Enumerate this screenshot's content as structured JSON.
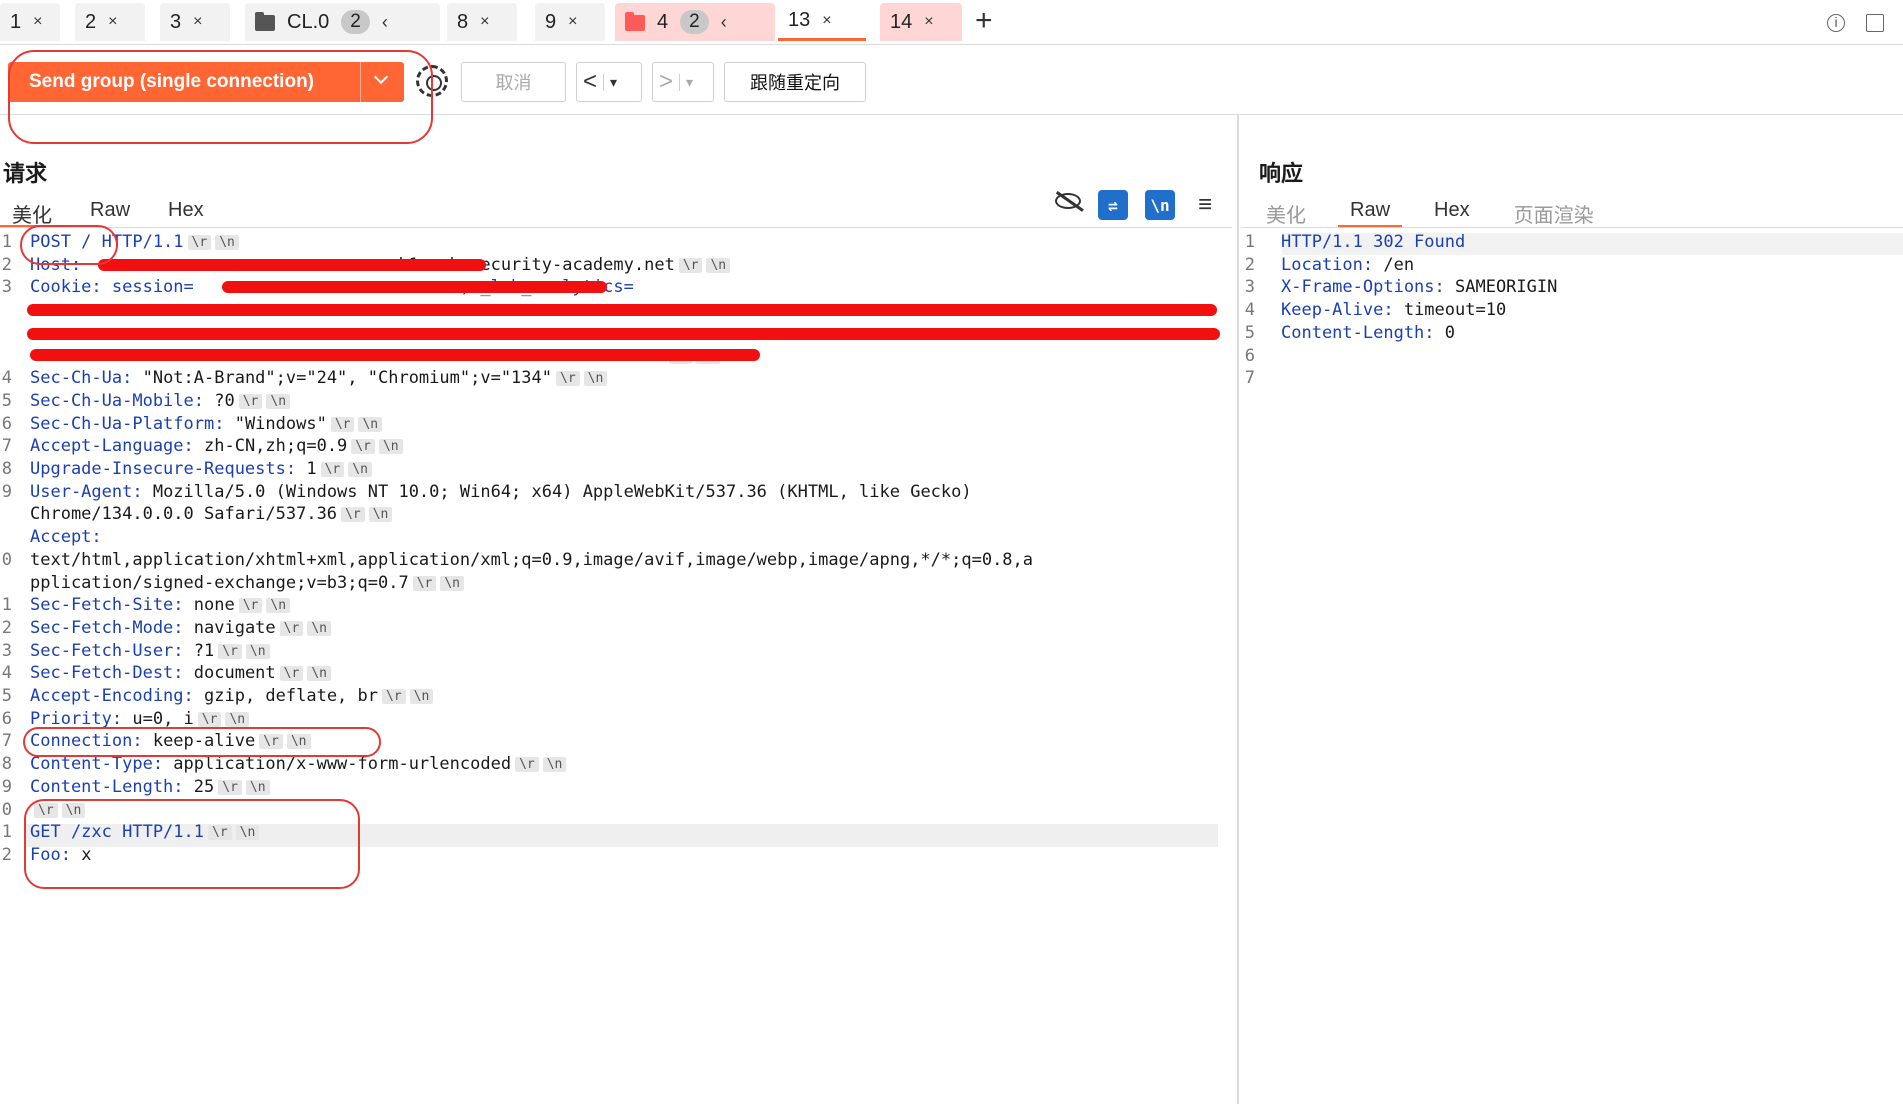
{
  "tabs": [
    {
      "label": "1",
      "close": "×"
    },
    {
      "label": "2",
      "close": "×"
    },
    {
      "label": "3",
      "close": "×"
    },
    {
      "label": "CL.0",
      "count": "2",
      "nav": "‹"
    },
    {
      "label": "8",
      "close": "×"
    },
    {
      "label": "9",
      "close": "×"
    },
    {
      "label": "4",
      "count": "2",
      "nav": "‹"
    },
    {
      "label": "13",
      "close": "×"
    },
    {
      "label": "14",
      "close": "×"
    }
  ],
  "new_tab": "+",
  "toolbar": {
    "send_label": "Send group (single connection)",
    "cancel_label": "取消",
    "follow_redirect_label": "跟随重定向",
    "back": "<",
    "forward": ">",
    "dropdown": "▾"
  },
  "request": {
    "title": "请求",
    "tabs": [
      "美化",
      "Raw",
      "Hex"
    ],
    "active_tab": "美化",
    "crlf": [
      "\\r",
      "\\n"
    ],
    "lines": [
      {
        "gutter": "1",
        "key": "POST / HTTP/1.1",
        "val": "",
        "crlf": true
      },
      {
        "gutter": "2",
        "key": "Host: ",
        "val": "                             .h1-web-security-academy.net",
        "crlf": true
      },
      {
        "gutter": "3",
        "key": "Cookie: session=                          ; _lab_analytics=",
        "val": "",
        "crlf": false
      },
      {
        "gutter": "",
        "key": "",
        "val": "",
        "crlf": false
      },
      {
        "gutter": "",
        "key": "",
        "val": "",
        "crlf": false
      },
      {
        "gutter": "",
        "key": "",
        "val": "                                                              ",
        "crlf": true
      },
      {
        "gutter": "4",
        "key": "Sec-Ch-Ua: ",
        "val": "\"Not:A-Brand\";v=\"24\", \"Chromium\";v=\"134\"",
        "crlf": true
      },
      {
        "gutter": "5",
        "key": "Sec-Ch-Ua-Mobile: ",
        "val": "?0",
        "crlf": true
      },
      {
        "gutter": "6",
        "key": "Sec-Ch-Ua-Platform: ",
        "val": "\"Windows\"",
        "crlf": true
      },
      {
        "gutter": "7",
        "key": "Accept-Language: ",
        "val": "zh-CN,zh;q=0.9",
        "crlf": true
      },
      {
        "gutter": "8",
        "key": "Upgrade-Insecure-Requests: ",
        "val": "1",
        "crlf": true
      },
      {
        "gutter": "9",
        "key": "User-Agent: ",
        "val": "Mozilla/5.0 (Windows NT 10.0; Win64; x64) AppleWebKit/537.36 (KHTML, like Gecko)",
        "crlf": false
      },
      {
        "gutter": "",
        "key": "",
        "val": "Chrome/134.0.0.0 Safari/537.36",
        "crlf": true
      },
      {
        "gutter": "",
        "key": "Accept: ",
        "val": "",
        "crlf": false
      },
      {
        "gutter": "0",
        "key": "",
        "val": "text/html,application/xhtml+xml,application/xml;q=0.9,image/avif,image/webp,image/apng,*/*;q=0.8,a",
        "crlf": false
      },
      {
        "gutter": "",
        "key": "",
        "val": "pplication/signed-exchange;v=b3;q=0.7",
        "crlf": true
      },
      {
        "gutter": "1",
        "key": "Sec-Fetch-Site: ",
        "val": "none",
        "crlf": true
      },
      {
        "gutter": "2",
        "key": "Sec-Fetch-Mode: ",
        "val": "navigate",
        "crlf": true
      },
      {
        "gutter": "3",
        "key": "Sec-Fetch-User: ",
        "val": "?1",
        "crlf": true
      },
      {
        "gutter": "4",
        "key": "Sec-Fetch-Dest: ",
        "val": "document",
        "crlf": true
      },
      {
        "gutter": "5",
        "key": "Accept-Encoding: ",
        "val": "gzip, deflate, br",
        "crlf": true
      },
      {
        "gutter": "6",
        "key": "Priority: ",
        "val": "u=0, i",
        "crlf": true
      },
      {
        "gutter": "7",
        "key": "Connection: ",
        "val": "keep-alive",
        "crlf": true
      },
      {
        "gutter": "8",
        "key": "Content-Type: ",
        "val": "application/x-www-form-urlencoded",
        "crlf": true
      },
      {
        "gutter": "9",
        "key": "Content-Length: ",
        "val": "25",
        "crlf": true
      },
      {
        "gutter": "0",
        "key": "",
        "val": "",
        "crlf": true
      },
      {
        "gutter": "1",
        "key": "GET /zxc HTTP/1.1",
        "val": "",
        "crlf": true
      },
      {
        "gutter": "2",
        "key": "Foo: ",
        "val": "x",
        "crlf": false
      }
    ]
  },
  "response": {
    "title": "响应",
    "tabs": [
      "美化",
      "Raw",
      "Hex",
      "页面渲染"
    ],
    "active_tab": "Raw",
    "lines": [
      {
        "gutter": "1",
        "key": "HTTP/1.1 302 Found",
        "val": ""
      },
      {
        "gutter": "2",
        "key": "Location: ",
        "val": "/en"
      },
      {
        "gutter": "3",
        "key": "X-Frame-Options: ",
        "val": "SAMEORIGIN"
      },
      {
        "gutter": "4",
        "key": "Keep-Alive: ",
        "val": "timeout=10"
      },
      {
        "gutter": "5",
        "key": "Content-Length: ",
        "val": "0"
      },
      {
        "gutter": "6",
        "key": "",
        "val": ""
      },
      {
        "gutter": "7",
        "key": "",
        "val": ""
      }
    ]
  },
  "colors": {
    "accent": "#ff6633",
    "key": "#1a3fb3",
    "redaction": "#f20f0f",
    "annotation": "#e53935",
    "icon_blue": "#1f6fcb"
  },
  "icons": [
    "settings-gear-icon",
    "hide-eye-icon",
    "wrap-lines-icon",
    "newline-toggle-icon",
    "menu-icon",
    "info-icon",
    "popout-icon"
  ]
}
